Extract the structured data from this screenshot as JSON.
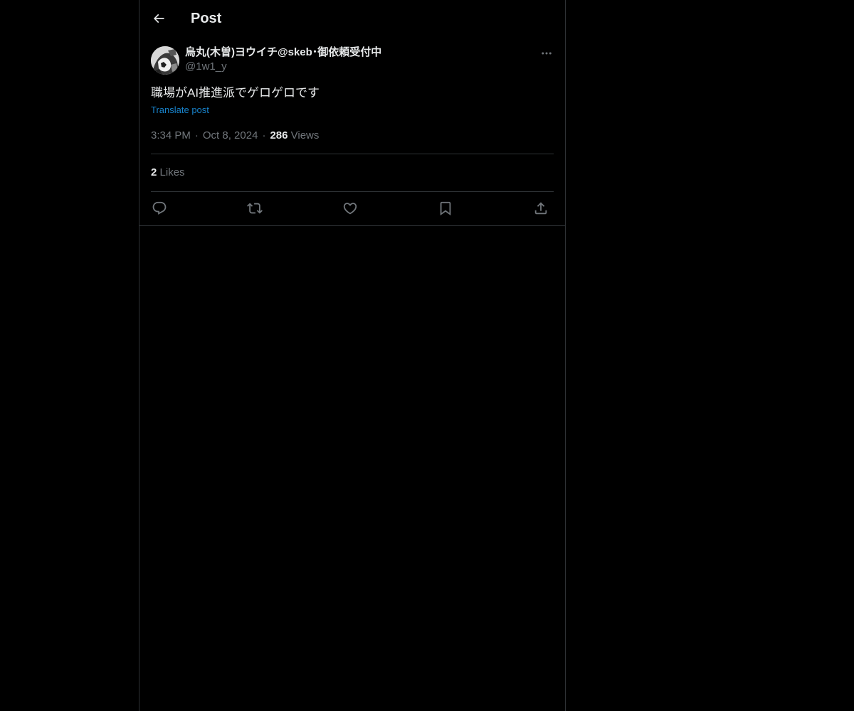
{
  "header": {
    "title": "Post",
    "back_icon": "arrow-left-icon"
  },
  "author": {
    "display_name": "烏丸(木曽)ヨウイチ@skeb･御依頼受付中",
    "handle": "@1w1_y",
    "avatar_icon": "user-avatar"
  },
  "post": {
    "text": "職場がAI推進派でゲロゲロです",
    "translate_label": "Translate post",
    "time": "3:34 PM",
    "date": "Oct 8, 2024",
    "views_count": "286",
    "views_label": "Views",
    "separator": "·"
  },
  "stats": {
    "likes_count": "2",
    "likes_label": "Likes"
  },
  "actions": [
    {
      "name": "reply",
      "icon": "reply-icon"
    },
    {
      "name": "repost",
      "icon": "repost-icon"
    },
    {
      "name": "like",
      "icon": "heart-icon"
    },
    {
      "name": "bookmark",
      "icon": "bookmark-icon"
    },
    {
      "name": "share",
      "icon": "share-icon"
    }
  ],
  "colors": {
    "background": "#000000",
    "text_primary": "#e7e9ea",
    "text_secondary": "#71767b",
    "link": "#1d9bf0",
    "border": "#2f3336"
  }
}
